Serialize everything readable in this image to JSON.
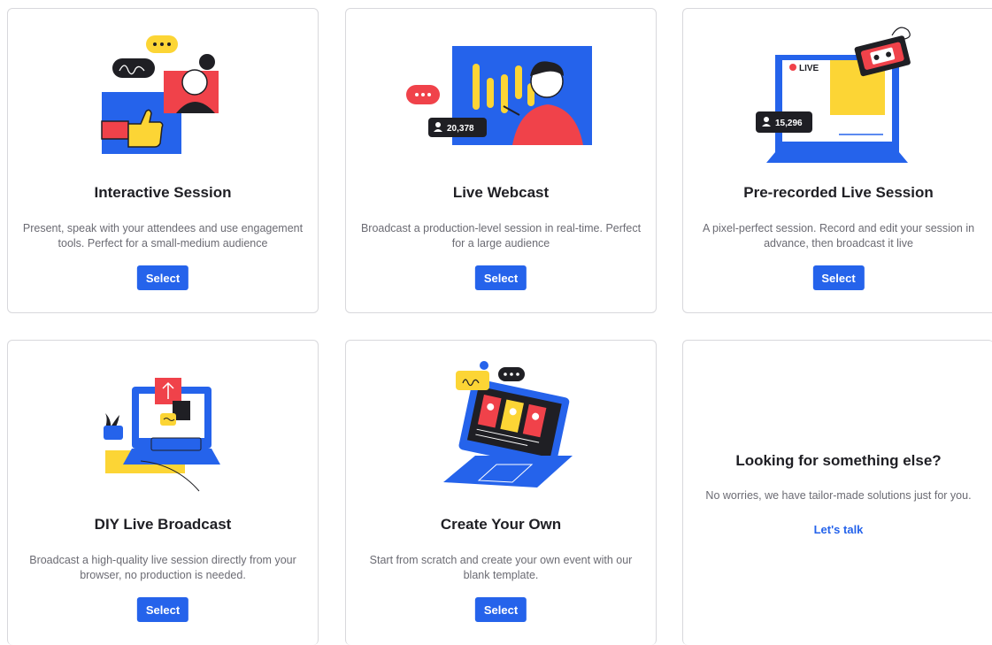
{
  "cards": [
    {
      "title": "Interactive Session",
      "description": "Present, speak with your attendees and use engagement tools. Perfect for a small-medium audience",
      "button": "Select"
    },
    {
      "title": "Live Webcast",
      "description": "Broadcast a production-level session in real-time. Perfect for a large audience",
      "button": "Select",
      "viewer_count": "20,378"
    },
    {
      "title": "Pre-recorded Live Session",
      "description": "A pixel-perfect session. Record and edit your session in advance, then broadcast it live",
      "button": "Select",
      "viewer_count": "15,296",
      "live_label": "LIVE"
    },
    {
      "title": "DIY Live Broadcast",
      "description": "Broadcast a high-quality live session directly from your browser, no production is needed.",
      "button": "Select"
    },
    {
      "title": "Create Your Own",
      "description": "Start from scratch and create your own event with our blank template.",
      "button": "Select"
    },
    {
      "title": "Looking for something else?",
      "description": "No worries, we have tailor-made solutions just for you.",
      "link": "Let's talk"
    }
  ],
  "colors": {
    "accent": "#2563eb",
    "red": "#f0424a",
    "yellow": "#fcd535",
    "dark": "#1f1f24"
  }
}
